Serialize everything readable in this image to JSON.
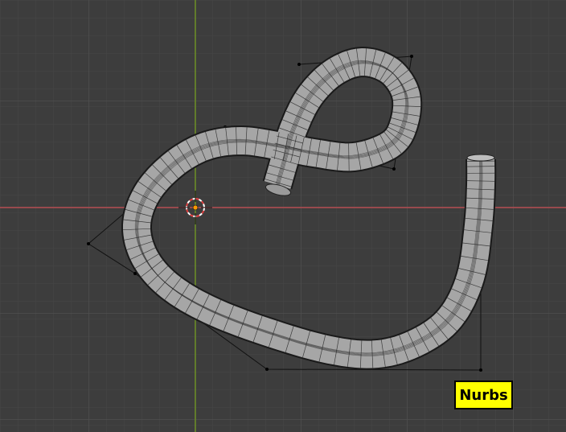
{
  "scene": {
    "label": "Nurbs",
    "colors": {
      "background": "#3d3d3d",
      "grid_minor": "#464646",
      "grid_major": "#515151",
      "x_axis": "#b34b50",
      "y_axis": "#6b8e23",
      "tube_fill": "#a6a6a6",
      "tube_wire": "#222222",
      "control_poly": "#111111",
      "cursor_ring_red": "#e04040",
      "cursor_ring_white": "#ffffff",
      "origin_dot": "#ff9900",
      "badge_bg": "#ffff00"
    },
    "icons": [
      "3d-cursor-icon",
      "object-origin-icon"
    ]
  }
}
